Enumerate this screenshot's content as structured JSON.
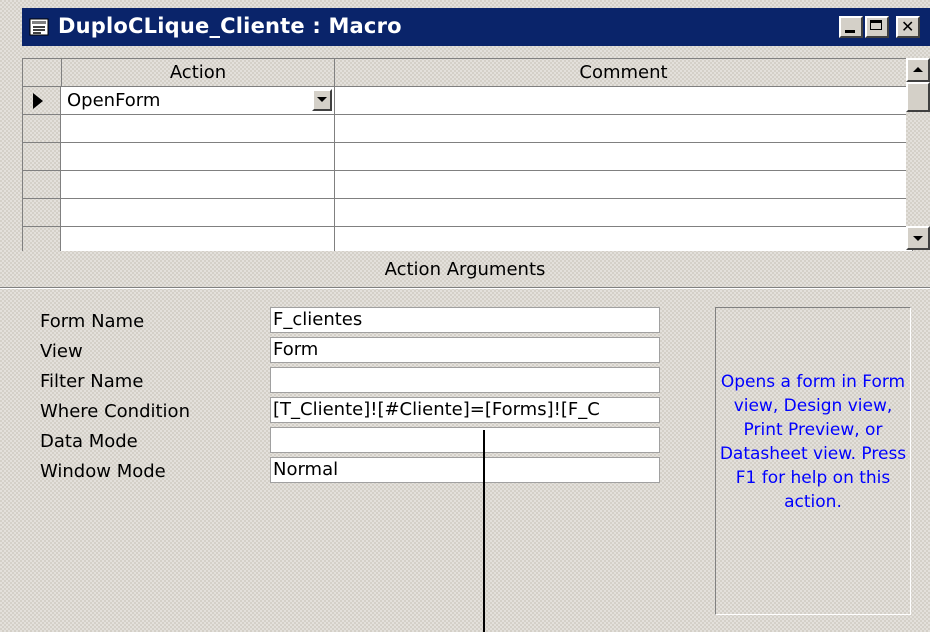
{
  "window": {
    "title": "DuploCLique_Cliente : Macro",
    "controls": {
      "minimize": "minimize",
      "maximize": "maximize",
      "close": "close"
    }
  },
  "grid": {
    "headers": {
      "action": "Action",
      "comment": "Comment"
    },
    "rows": [
      {
        "action": "OpenForm",
        "comment": "",
        "current": true
      },
      {
        "action": "",
        "comment": ""
      },
      {
        "action": "",
        "comment": ""
      },
      {
        "action": "",
        "comment": ""
      },
      {
        "action": "",
        "comment": ""
      }
    ]
  },
  "action_arguments": {
    "title": "Action Arguments",
    "fields": [
      {
        "label": "Form Name",
        "value": "F_clientes"
      },
      {
        "label": "View",
        "value": "Form"
      },
      {
        "label": "Filter Name",
        "value": ""
      },
      {
        "label": "Where Condition",
        "value": "[T_Cliente]![#Cliente]=[Forms]![F_C"
      },
      {
        "label": "Data Mode",
        "value": ""
      },
      {
        "label": "Window Mode",
        "value": "Normal"
      }
    ]
  },
  "help": {
    "text": "Opens a form in Form view, Design view, Print Preview, or Datasheet view. Press F1 for help on this action.",
    "color": "#0000ff"
  },
  "colors": {
    "titlebar": "#0a246a",
    "face": "#d4d0c8"
  }
}
